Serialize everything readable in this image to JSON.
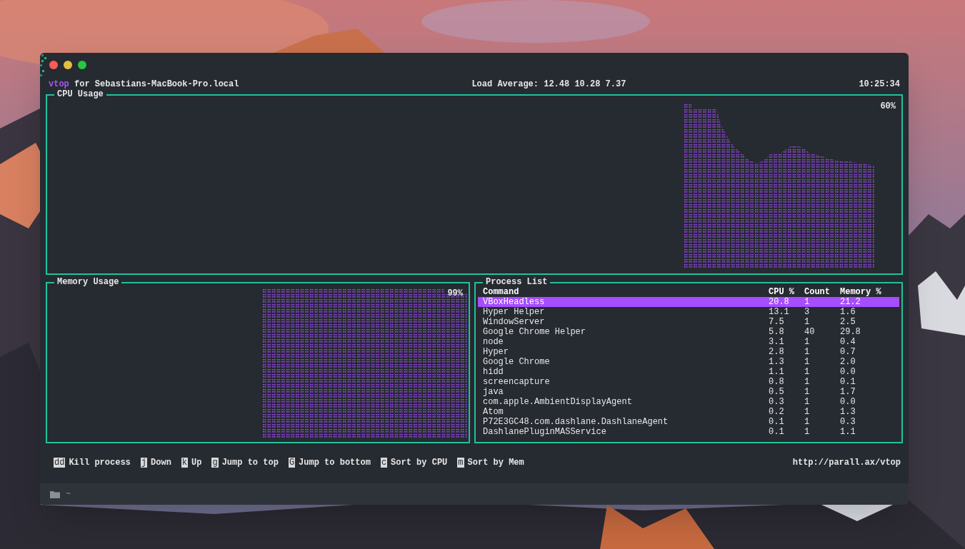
{
  "title_line": {
    "app": "vtop",
    "host_text": "for Sebastians-MacBook-Pro.local",
    "load_average": "Load Average: 12.48 10.28 7.37",
    "time": "10:25:34"
  },
  "cpu_panel": {
    "title": "CPU Usage",
    "reading": "60%"
  },
  "memory_panel": {
    "title": "Memory Usage",
    "reading": "99%"
  },
  "process_list": {
    "title": "Process List",
    "columns": [
      "Command",
      "CPU %",
      "Count",
      "Memory %"
    ],
    "rows": [
      {
        "command": "VBoxHeadless",
        "cpu": "20.8",
        "count": "1",
        "memory": "21.2",
        "selected": true
      },
      {
        "command": "Hyper Helper",
        "cpu": "13.1",
        "count": "3",
        "memory": "1.6",
        "selected": false
      },
      {
        "command": "WindowServer",
        "cpu": "7.5",
        "count": "1",
        "memory": "2.5",
        "selected": false
      },
      {
        "command": "Google Chrome Helper",
        "cpu": "5.8",
        "count": "40",
        "memory": "29.8",
        "selected": false
      },
      {
        "command": "node",
        "cpu": "3.1",
        "count": "1",
        "memory": "0.4",
        "selected": false
      },
      {
        "command": "Hyper",
        "cpu": "2.8",
        "count": "1",
        "memory": "0.7",
        "selected": false
      },
      {
        "command": "Google Chrome",
        "cpu": "1.3",
        "count": "1",
        "memory": "2.0",
        "selected": false
      },
      {
        "command": "hidd",
        "cpu": "1.1",
        "count": "1",
        "memory": "0.0",
        "selected": false
      },
      {
        "command": "screencapture",
        "cpu": "0.8",
        "count": "1",
        "memory": "0.1",
        "selected": false
      },
      {
        "command": "java",
        "cpu": "0.5",
        "count": "1",
        "memory": "1.7",
        "selected": false
      },
      {
        "command": "com.apple.AmbientDisplayAgent",
        "cpu": "0.3",
        "count": "1",
        "memory": "0.0",
        "selected": false
      },
      {
        "command": "Atom",
        "cpu": "0.2",
        "count": "1",
        "memory": "1.3",
        "selected": false
      },
      {
        "command": "P72E3GC48.com.dashlane.DashlaneAgent",
        "cpu": "0.1",
        "count": "1",
        "memory": "0.3",
        "selected": false
      },
      {
        "command": "DashlanePluginMASService",
        "cpu": "0.1",
        "count": "1",
        "memory": "1.1",
        "selected": false
      }
    ]
  },
  "key_hints": [
    {
      "key": "dd",
      "label": "Kill process"
    },
    {
      "key": "j",
      "label": "Down"
    },
    {
      "key": "k",
      "label": "Up"
    },
    {
      "key": "g",
      "label": "Jump to top"
    },
    {
      "key": "G",
      "label": "Jump to bottom"
    },
    {
      "key": "c",
      "label": "Sort by CPU"
    },
    {
      "key": "m",
      "label": "Sort by Mem"
    }
  ],
  "url": "http://parall.ax/vtop",
  "prompt": {
    "text": "~"
  }
}
